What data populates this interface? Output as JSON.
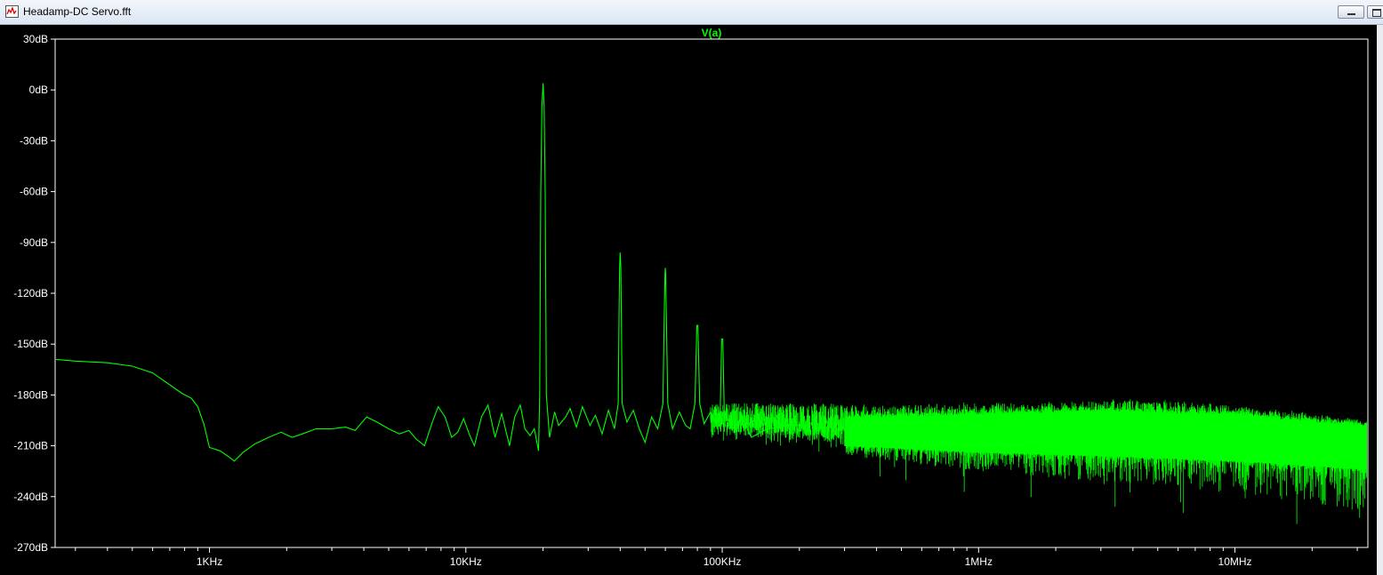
{
  "window": {
    "title": "Headamp-DC Servo.fft"
  },
  "icons": {
    "window_icon": "waveform-plot-icon",
    "minimize": "minimize-icon",
    "maximize": "restore-icon"
  },
  "colors": {
    "background": "#000000",
    "trace": "#00ff00",
    "axis_text": "#ffffff",
    "frame": "#ffffff"
  },
  "chart_data": {
    "type": "line",
    "title": "V(a)",
    "x_scale": "log",
    "y_scale": "dB",
    "xlim": [
      250,
      33000000
    ],
    "ylim": [
      -270,
      30
    ],
    "grid": false,
    "x_ticks": [
      {
        "value": 1000,
        "label": "1KHz"
      },
      {
        "value": 10000,
        "label": "10KHz"
      },
      {
        "value": 100000,
        "label": "100KHz"
      },
      {
        "value": 1000000,
        "label": "1MHz"
      },
      {
        "value": 10000000,
        "label": "10MHz"
      }
    ],
    "y_ticks": [
      {
        "value": 30,
        "label": "30dB"
      },
      {
        "value": 0,
        "label": "0dB"
      },
      {
        "value": -30,
        "label": "-30dB"
      },
      {
        "value": -60,
        "label": "-60dB"
      },
      {
        "value": -90,
        "label": "-90dB"
      },
      {
        "value": -120,
        "label": "-120dB"
      },
      {
        "value": -150,
        "label": "-150dB"
      },
      {
        "value": -180,
        "label": "-180dB"
      },
      {
        "value": -210,
        "label": "-210dB"
      },
      {
        "value": -240,
        "label": "-240dB"
      },
      {
        "value": -270,
        "label": "-270dB"
      }
    ],
    "series": [
      {
        "name": "V(a)",
        "color": "#00ff00",
        "points": [
          [
            250,
            -159
          ],
          [
            300,
            -160
          ],
          [
            400,
            -161
          ],
          [
            500,
            -163
          ],
          [
            600,
            -167
          ],
          [
            700,
            -174
          ],
          [
            780,
            -179
          ],
          [
            850,
            -182
          ],
          [
            900,
            -187
          ],
          [
            950,
            -197
          ],
          [
            1000,
            -211
          ],
          [
            1100,
            -213
          ],
          [
            1200,
            -217
          ],
          [
            1250,
            -219
          ],
          [
            1350,
            -214
          ],
          [
            1500,
            -209
          ],
          [
            1700,
            -205
          ],
          [
            1900,
            -202
          ],
          [
            2100,
            -205
          ],
          [
            2300,
            -203
          ],
          [
            2600,
            -200
          ],
          [
            3000,
            -200
          ],
          [
            3400,
            -199
          ],
          [
            3700,
            -201
          ],
          [
            4100,
            -193
          ],
          [
            4500,
            -196
          ],
          [
            5000,
            -200
          ],
          [
            5500,
            -203
          ],
          [
            6000,
            -201
          ],
          [
            6400,
            -206
          ],
          [
            6900,
            -210
          ],
          [
            7400,
            -196
          ],
          [
            7800,
            -187
          ],
          [
            8300,
            -193
          ],
          [
            8800,
            -205
          ],
          [
            9300,
            -202
          ],
          [
            9800,
            -194
          ],
          [
            10300,
            -203
          ],
          [
            10800,
            -210
          ],
          [
            11500,
            -193
          ],
          [
            12200,
            -186
          ],
          [
            13000,
            -205
          ],
          [
            13800,
            -191
          ],
          [
            14800,
            -210
          ],
          [
            15500,
            -193
          ],
          [
            16300,
            -186
          ],
          [
            17000,
            -200
          ],
          [
            17800,
            -204
          ],
          [
            18500,
            -200
          ],
          [
            19200,
            -213
          ],
          [
            19400,
            -180
          ],
          [
            19600,
            -60
          ],
          [
            19800,
            -10
          ],
          [
            20000,
            4
          ],
          [
            20200,
            -10
          ],
          [
            20400,
            -60
          ],
          [
            20600,
            -180
          ],
          [
            21200,
            -205
          ],
          [
            22200,
            -190
          ],
          [
            23000,
            -198
          ],
          [
            24500,
            -193
          ],
          [
            25500,
            -188
          ],
          [
            27000,
            -199
          ],
          [
            28500,
            -187
          ],
          [
            30500,
            -198
          ],
          [
            32000,
            -192
          ],
          [
            34000,
            -203
          ],
          [
            36000,
            -189
          ],
          [
            38000,
            -200
          ],
          [
            39300,
            -185
          ],
          [
            39600,
            -130
          ],
          [
            39800,
            -104
          ],
          [
            40000,
            -96
          ],
          [
            40200,
            -104
          ],
          [
            40400,
            -130
          ],
          [
            40700,
            -185
          ],
          [
            42500,
            -196
          ],
          [
            45000,
            -189
          ],
          [
            47500,
            -200
          ],
          [
            50000,
            -208
          ],
          [
            53000,
            -193
          ],
          [
            56000,
            -200
          ],
          [
            58700,
            -185
          ],
          [
            59400,
            -135
          ],
          [
            59800,
            -109
          ],
          [
            60000,
            -105
          ],
          [
            60200,
            -109
          ],
          [
            60600,
            -135
          ],
          [
            61300,
            -185
          ],
          [
            64000,
            -200
          ],
          [
            68000,
            -190
          ],
          [
            72000,
            -198
          ],
          [
            75000,
            -200
          ],
          [
            78300,
            -185
          ],
          [
            79600,
            -139
          ],
          [
            80400,
            -139
          ],
          [
            81700,
            -185
          ],
          [
            85000,
            -197
          ],
          [
            90000,
            -190
          ],
          [
            95000,
            -198
          ],
          [
            98200,
            -190
          ],
          [
            99500,
            -147
          ],
          [
            100500,
            -147
          ],
          [
            101800,
            -190
          ],
          [
            110000,
            -200
          ],
          [
            120000,
            -194
          ],
          [
            130000,
            -205
          ],
          [
            150000,
            -200
          ],
          [
            180000,
            -198
          ],
          [
            220000,
            -198
          ]
        ],
        "noise_band": {
          "description": "dense noise floor",
          "upper": [
            [
              90000,
              -184
            ],
            [
              200000,
              -185
            ],
            [
              500000,
              -185
            ],
            [
              1000000,
              -184
            ],
            [
              2000000,
              -184
            ],
            [
              4000000,
              -182
            ],
            [
              8000000,
              -184
            ],
            [
              15000000,
              -188
            ],
            [
              33000000,
              -194
            ]
          ],
          "lower": [
            [
              90000,
              -207
            ],
            [
              200000,
              -212
            ],
            [
              500000,
              -220
            ],
            [
              1000000,
              -225
            ],
            [
              2000000,
              -229
            ],
            [
              4000000,
              -233
            ],
            [
              8000000,
              -237
            ],
            [
              15000000,
              -242
            ],
            [
              33000000,
              -249
            ]
          ],
          "dense_lower": [
            [
              300000,
              -210
            ],
            [
              1000000,
              -214
            ],
            [
              3000000,
              -216
            ],
            [
              10000000,
              -219
            ],
            [
              33000000,
              -224
            ]
          ],
          "dense_upper": [
            [
              300000,
              -192
            ],
            [
              1000000,
              -190
            ],
            [
              3000000,
              -188
            ],
            [
              10000000,
              -190
            ],
            [
              33000000,
              -197
            ]
          ]
        }
      }
    ]
  }
}
